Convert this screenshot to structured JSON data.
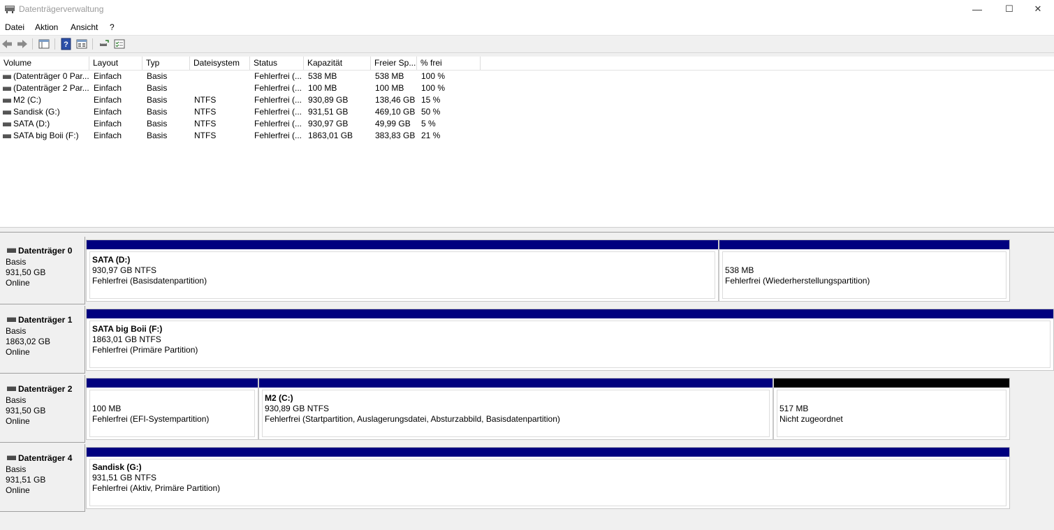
{
  "window": {
    "title": "Datenträgerverwaltung",
    "minimize": "—",
    "maximize": "☐",
    "close": "✕"
  },
  "menu": {
    "file": "Datei",
    "action": "Aktion",
    "view": "Ansicht",
    "help": "?"
  },
  "volumes": {
    "headers": [
      "Volume",
      "Layout",
      "Typ",
      "Dateisystem",
      "Status",
      "Kapazität",
      "Freier Sp...",
      "% frei"
    ],
    "rows": [
      [
        "(Datenträger 0 Par...",
        "Einfach",
        "Basis",
        "",
        "Fehlerfrei (...",
        "538 MB",
        "538 MB",
        "100 %"
      ],
      [
        "(Datenträger 2 Par...",
        "Einfach",
        "Basis",
        "",
        "Fehlerfrei (...",
        "100 MB",
        "100 MB",
        "100 %"
      ],
      [
        "M2 (C:)",
        "Einfach",
        "Basis",
        "NTFS",
        "Fehlerfrei (...",
        "930,89 GB",
        "138,46 GB",
        "15 %"
      ],
      [
        "Sandisk (G:)",
        "Einfach",
        "Basis",
        "NTFS",
        "Fehlerfrei (...",
        "931,51 GB",
        "469,10 GB",
        "50 %"
      ],
      [
        "SATA (D:)",
        "Einfach",
        "Basis",
        "NTFS",
        "Fehlerfrei (...",
        "930,97 GB",
        "49,99 GB",
        "5 %"
      ],
      [
        "SATA big Boii (F:)",
        "Einfach",
        "Basis",
        "NTFS",
        "Fehlerfrei (...",
        "1863,01 GB",
        "383,83 GB",
        "21 %"
      ]
    ]
  },
  "disks": [
    {
      "name": "Datenträger 0",
      "type": "Basis",
      "size": "931,50 GB",
      "state": "Online",
      "partitions": [
        {
          "title": "SATA  (D:)",
          "size": "930,97 GB NTFS",
          "status": "Fehlerfrei (Basisdatenpartition)",
          "bar": "#00007f"
        },
        {
          "title": "",
          "size": "538 MB",
          "status": "Fehlerfrei (Wiederherstellungspartition)",
          "bar": "#00007f"
        }
      ]
    },
    {
      "name": "Datenträger 1",
      "type": "Basis",
      "size": "1863,02 GB",
      "state": "Online",
      "partitions": [
        {
          "title": "SATA big Boii  (F:)",
          "size": "1863,01 GB NTFS",
          "status": "Fehlerfrei (Primäre Partition)",
          "bar": "#00007f"
        }
      ]
    },
    {
      "name": "Datenträger 2",
      "type": "Basis",
      "size": "931,50 GB",
      "state": "Online",
      "partitions": [
        {
          "title": "",
          "size": "100 MB",
          "status": "Fehlerfrei (EFI-Systempartition)",
          "bar": "#00007f"
        },
        {
          "title": "M2  (C:)",
          "size": "930,89 GB NTFS",
          "status": "Fehlerfrei (Startpartition, Auslagerungsdatei, Absturzabbild, Basisdatenpartition)",
          "bar": "#00007f"
        },
        {
          "title": "",
          "size": "517 MB",
          "status": "Nicht zugeordnet",
          "bar": "#000000"
        }
      ]
    },
    {
      "name": "Datenträger 4",
      "type": "Basis",
      "size": "931,51 GB",
      "state": "Online",
      "partitions": [
        {
          "title": "Sandisk  (G:)",
          "size": "931,51 GB NTFS",
          "status": "Fehlerfrei (Aktiv, Primäre Partition)",
          "bar": "#00007f"
        }
      ]
    }
  ]
}
